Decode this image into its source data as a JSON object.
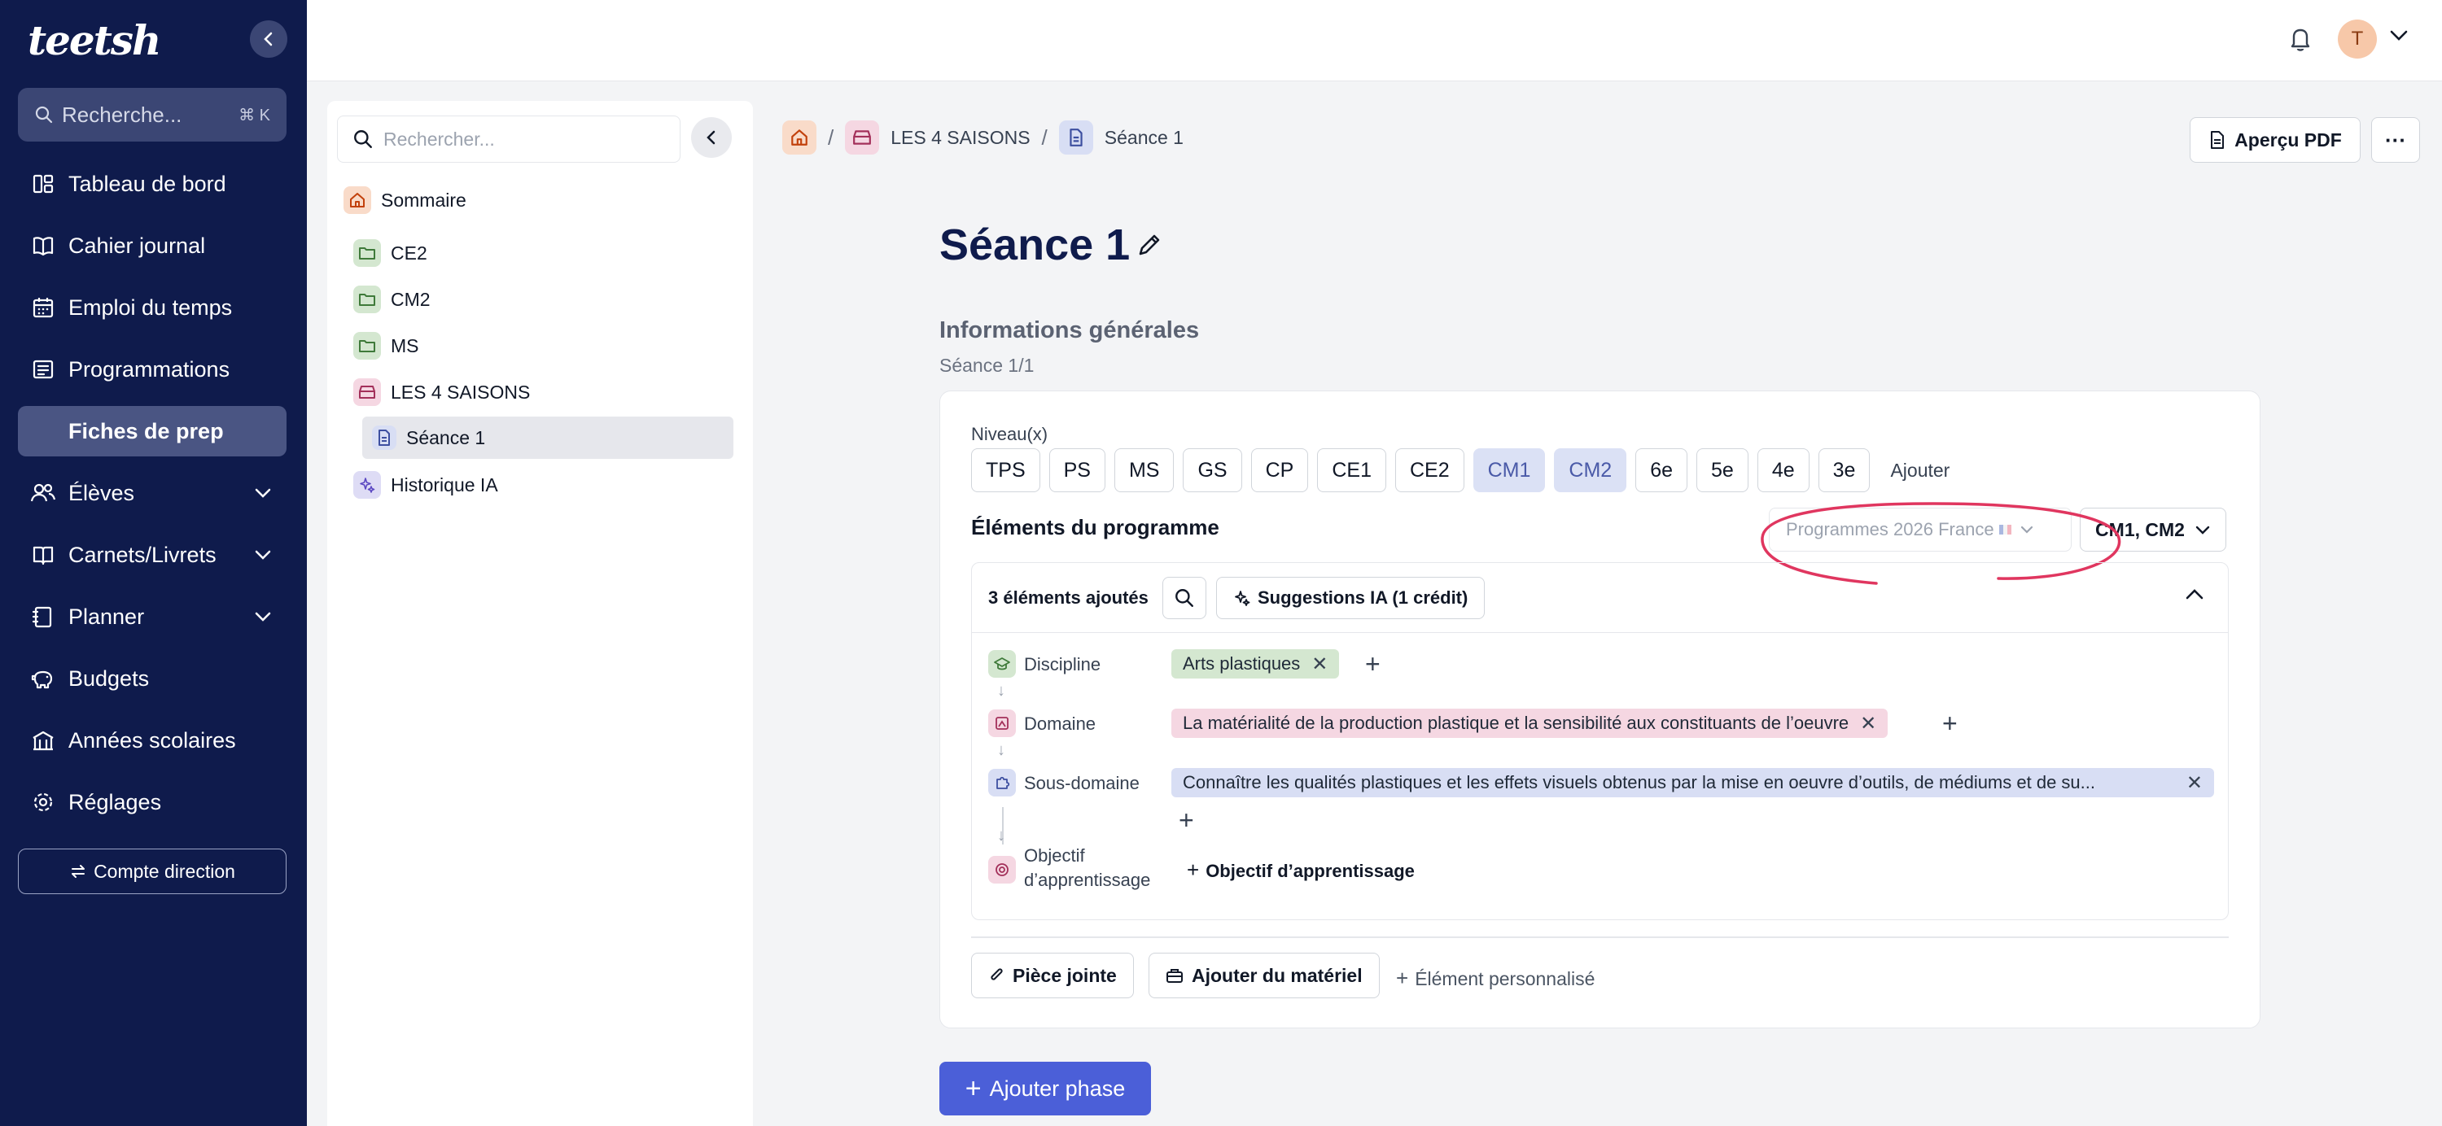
{
  "app": {
    "logo_text": "teetsh",
    "logo_accent": "#e03a5b"
  },
  "sidebar": {
    "search_placeholder": "Recherche...",
    "search_shortcut": "⌘ K",
    "items": [
      {
        "label": "Tableau de bord",
        "icon": "dashboard-icon",
        "active": false
      },
      {
        "label": "Cahier journal",
        "icon": "book-icon",
        "active": false
      },
      {
        "label": "Emploi du temps",
        "icon": "calendar-icon",
        "active": false
      },
      {
        "label": "Programmations",
        "icon": "programmation-icon",
        "active": false
      },
      {
        "label": "Fiches de prep",
        "icon": "file-icon",
        "active": true
      },
      {
        "label": "Élèves",
        "icon": "users-icon",
        "active": false,
        "expandable": true
      },
      {
        "label": "Carnets/Livrets",
        "icon": "notebook-icon",
        "active": false,
        "expandable": true
      },
      {
        "label": "Planner",
        "icon": "planner-icon",
        "active": false,
        "expandable": true
      },
      {
        "label": "Budgets",
        "icon": "piggy-bank-icon",
        "active": false
      },
      {
        "label": "Années scolaires",
        "icon": "school-icon",
        "active": false
      },
      {
        "label": "Réglages",
        "icon": "gear-icon",
        "active": false
      }
    ],
    "direction_button": "Compte direction"
  },
  "topbar": {
    "avatar_initial": "T"
  },
  "tree": {
    "search_placeholder": "Rechercher...",
    "items": [
      {
        "label": "Sommaire",
        "icon": "home-icon"
      },
      {
        "label": "CE2",
        "icon": "folder-icon"
      },
      {
        "label": "CM2",
        "icon": "folder-icon"
      },
      {
        "label": "MS",
        "icon": "folder-icon"
      },
      {
        "label": "LES 4 SAISONS",
        "icon": "box-icon"
      },
      {
        "label": "Séance 1",
        "icon": "document-icon",
        "selected": true
      },
      {
        "label": "Historique IA",
        "icon": "sparkles-icon"
      }
    ]
  },
  "breadcrumb": {
    "items": [
      "LES 4 SAISONS",
      "Séance 1"
    ]
  },
  "header": {
    "pdf_button": "Aperçu PDF",
    "more_button": "···"
  },
  "page": {
    "title": "Séance 1",
    "section_title": "Informations générales",
    "section_subtitle": "Séance 1/1"
  },
  "niveau": {
    "label": "Niveau(x)",
    "levels": [
      {
        "label": "TPS",
        "selected": false
      },
      {
        "label": "PS",
        "selected": false
      },
      {
        "label": "MS",
        "selected": false
      },
      {
        "label": "GS",
        "selected": false
      },
      {
        "label": "CP",
        "selected": false
      },
      {
        "label": "CE1",
        "selected": false
      },
      {
        "label": "CE2",
        "selected": false
      },
      {
        "label": "CM1",
        "selected": true
      },
      {
        "label": "CM2",
        "selected": true
      },
      {
        "label": "6e",
        "selected": false
      },
      {
        "label": "5e",
        "selected": false
      },
      {
        "label": "4e",
        "selected": false
      },
      {
        "label": "3e",
        "selected": false
      }
    ],
    "add_label": "Ajouter"
  },
  "programme": {
    "title": "Éléments du programme",
    "program_select": "Programmes 2026 France",
    "level_select": "CM1, CM2",
    "annotation_color": "#e0365f",
    "count_label": "3 éléments ajoutés",
    "suggestions_button": "Suggestions IA (1 crédit)",
    "rows": [
      {
        "label": "Discipline",
        "tag": "Arts plastiques"
      },
      {
        "label": "Domaine",
        "tag": "La matérialité de la production plastique et la sensibilité aux constituants de l’oeuvre"
      },
      {
        "label": "Sous-domaine",
        "tag": "Connaître les qualités plastiques et les effets visuels obtenus par la mise en oeuvre d’outils, de médiums et de su..."
      },
      {
        "label_line1": "Objectif",
        "label_line2": "d’apprentissage",
        "add_label": "Objectif d’apprentissage"
      }
    ]
  },
  "footer_actions": {
    "attachment": "Pièce jointe",
    "material": "Ajouter du matériel",
    "custom": "Élément personnalisé"
  },
  "add_phase": "Ajouter phase"
}
